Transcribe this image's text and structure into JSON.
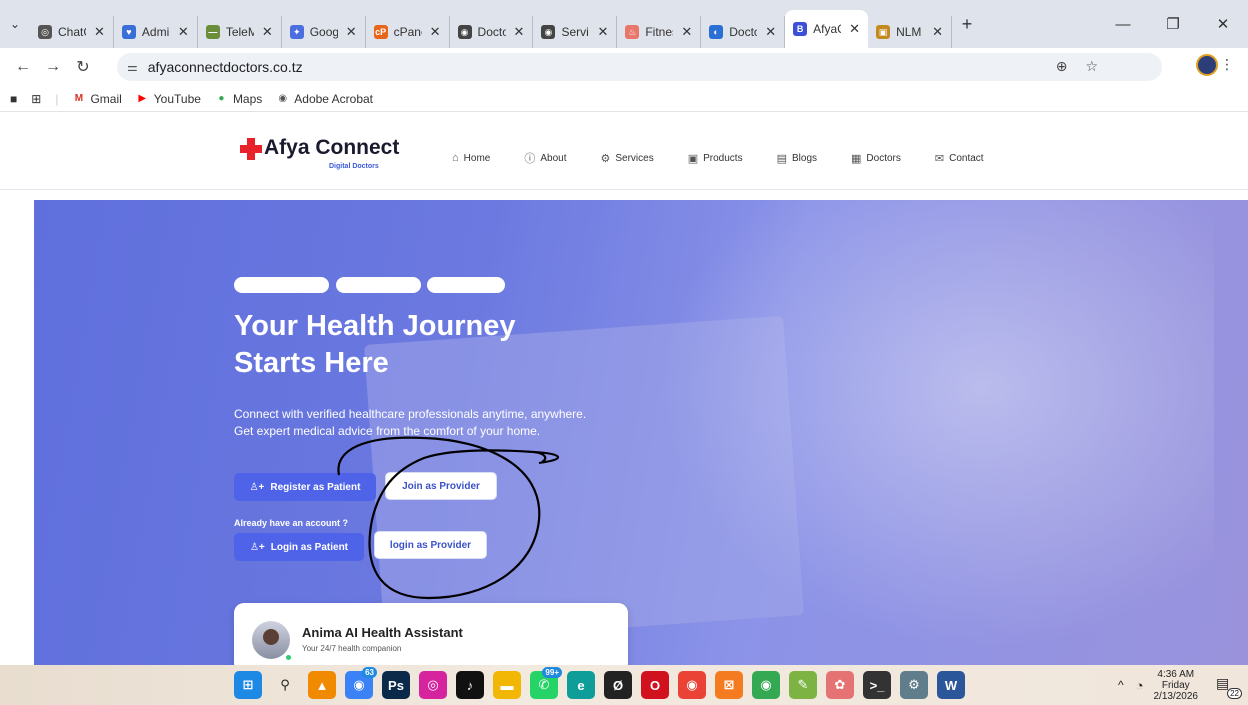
{
  "browser": {
    "tabs": [
      {
        "title": "ChatG",
        "color": "#555555",
        "glyph": "◎"
      },
      {
        "title": "Admi",
        "color": "#3a6fd8",
        "glyph": "♥"
      },
      {
        "title": "TeleM",
        "color": "#6b8e3a",
        "glyph": "—"
      },
      {
        "title": "Goog",
        "color": "#4a6ee0",
        "glyph": "✦"
      },
      {
        "title": "cPane",
        "color": "#e8661a",
        "glyph": "cP"
      },
      {
        "title": "Docto",
        "color": "#444444",
        "glyph": "◉"
      },
      {
        "title": "Servic",
        "color": "#444444",
        "glyph": "◉"
      },
      {
        "title": "Fitnes",
        "color": "#e8766a",
        "glyph": "♨"
      },
      {
        "title": "Docto",
        "color": "#2a6fd6",
        "glyph": "◐"
      },
      {
        "title": "AfyaC",
        "color": "#3b4fd8",
        "glyph": "B",
        "active": true
      },
      {
        "title": "NLM",
        "color": "#c48a20",
        "glyph": "▣"
      }
    ],
    "new_tab": "+",
    "address": "afyaconnectdoctors.co.tz",
    "bookmarks": [
      {
        "label": "Gmail",
        "icon": "gmail-icon",
        "glyph": "M",
        "color": "#d93025"
      },
      {
        "label": "YouTube",
        "icon": "youtube-icon",
        "glyph": "▶",
        "color": "#ff0000"
      },
      {
        "label": "Maps",
        "icon": "maps-icon",
        "glyph": "●",
        "color": "#34a853"
      },
      {
        "label": "Adobe Acrobat",
        "icon": "globe-icon",
        "glyph": "◉",
        "color": "#555555"
      }
    ]
  },
  "site": {
    "logo_text": "Afya Connect",
    "logo_sub": "Digital Doctors",
    "nav": [
      {
        "label": "Home",
        "icon": "home-icon",
        "glyph": "⌂"
      },
      {
        "label": "About",
        "icon": "info-icon",
        "glyph": "ⓘ"
      },
      {
        "label": "Services",
        "icon": "services-icon",
        "glyph": "⚙"
      },
      {
        "label": "Products",
        "icon": "products-icon",
        "glyph": "▣"
      },
      {
        "label": "Blogs",
        "icon": "blogs-icon",
        "glyph": "▤"
      },
      {
        "label": "Doctors",
        "icon": "doctors-icon",
        "glyph": "▦"
      },
      {
        "label": "Contact",
        "icon": "mail-icon",
        "glyph": "✉"
      }
    ],
    "hero": {
      "title_line1": "Your Health Journey",
      "title_line2": "Starts Here",
      "desc_line1": "Connect with verified healthcare professionals anytime, anywhere.",
      "desc_line2": "Get expert medical advice from the comfort of your home.",
      "register_patient": "Register as Patient",
      "join_provider": "Join as Provider",
      "already": "Already have an account ?",
      "login_patient": "Login as Patient",
      "login_provider": "login as Provider"
    },
    "assistant": {
      "title": "Anima AI Health Assistant",
      "subtitle": "Your 24/7 health companion"
    }
  },
  "taskbar": {
    "apps": [
      {
        "name": "windows-start-icon",
        "glyph": "⊞",
        "bg": "#1e88e5",
        "badge": ""
      },
      {
        "name": "search-icon",
        "glyph": "⚲",
        "bg": "transparent",
        "badge": ""
      },
      {
        "name": "vlc-icon",
        "glyph": "▲",
        "bg": "#f08a00",
        "badge": ""
      },
      {
        "name": "messenger-icon",
        "glyph": "◉",
        "bg": "#3b82f6",
        "badge": "63"
      },
      {
        "name": "photoshop-icon",
        "glyph": "Ps",
        "bg": "#0b2a4a",
        "badge": ""
      },
      {
        "name": "instagram-icon",
        "glyph": "◎",
        "bg": "#d6249f",
        "badge": ""
      },
      {
        "name": "tiktok-icon",
        "glyph": "♪",
        "bg": "#111111",
        "badge": ""
      },
      {
        "name": "file-explorer-icon",
        "glyph": "▬",
        "bg": "#f2b705",
        "badge": ""
      },
      {
        "name": "whatsapp-icon",
        "glyph": "✆",
        "bg": "#25d366",
        "badge": "99+"
      },
      {
        "name": "edge-icon",
        "glyph": "e",
        "bg": "#0f9d9a",
        "badge": ""
      },
      {
        "name": "app-icon",
        "glyph": "Ø",
        "bg": "#222222",
        "badge": ""
      },
      {
        "name": "opera-icon",
        "glyph": "O",
        "bg": "#d1121e",
        "badge": ""
      },
      {
        "name": "chrome-icon",
        "glyph": "◉",
        "bg": "#ea4335",
        "badge": ""
      },
      {
        "name": "xampp-icon",
        "glyph": "⊠",
        "bg": "#f57b20",
        "badge": ""
      },
      {
        "name": "chrome-profile-icon",
        "glyph": "◉",
        "bg": "#34a853",
        "badge": ""
      },
      {
        "name": "notes-icon",
        "glyph": "✎",
        "bg": "#7cb342",
        "badge": ""
      },
      {
        "name": "paint-icon",
        "glyph": "✿",
        "bg": "#e57373",
        "badge": ""
      },
      {
        "name": "terminal-icon",
        "glyph": ">_",
        "bg": "#333333",
        "badge": ""
      },
      {
        "name": "settings-icon",
        "glyph": "⚙",
        "bg": "#607d8b",
        "badge": ""
      },
      {
        "name": "word-icon",
        "glyph": "W",
        "bg": "#2b579a",
        "badge": ""
      }
    ],
    "time": "4:36 AM",
    "day": "Friday",
    "date": "2/13/2026",
    "notifications": "22"
  }
}
